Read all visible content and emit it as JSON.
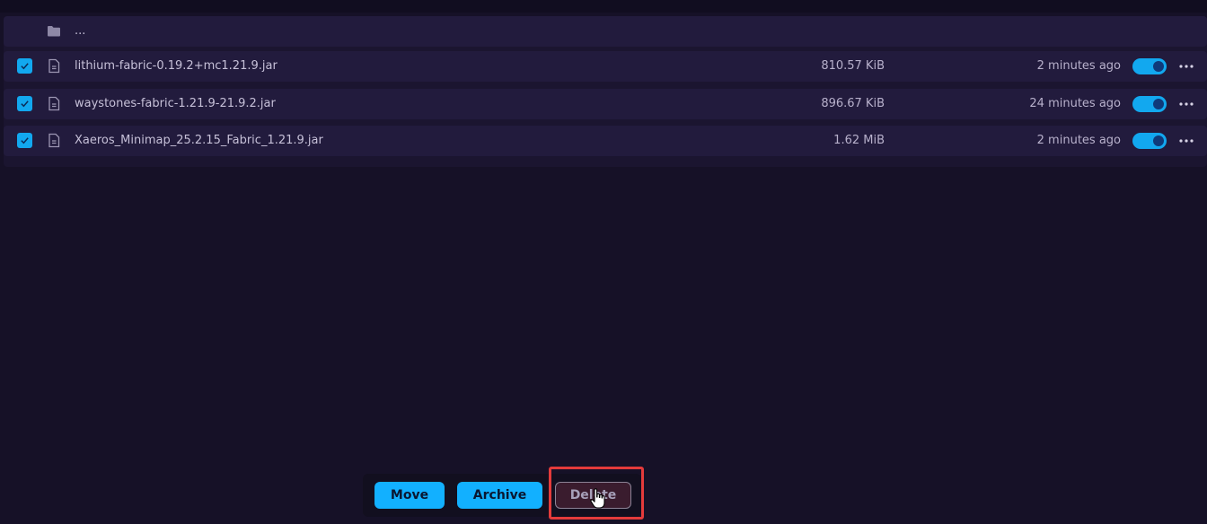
{
  "parent_row": {
    "label": "..."
  },
  "files": [
    {
      "name": "lithium-fabric-0.19.2+mc1.21.9.jar",
      "size": "810.57 KiB",
      "modified": "2 minutes ago",
      "checked": true,
      "enabled": true
    },
    {
      "name": "waystones-fabric-1.21.9-21.9.2.jar",
      "size": "896.67 KiB",
      "modified": "24 minutes ago",
      "checked": true,
      "enabled": true
    },
    {
      "name": "Xaeros_Minimap_25.2.15_Fabric_1.21.9.jar",
      "size": "1.62 MiB",
      "modified": "2 minutes ago",
      "checked": true,
      "enabled": true
    }
  ],
  "actions": {
    "move_label": "Move",
    "archive_label": "Archive",
    "delete_label": "Delete"
  },
  "colors": {
    "accent": "#12b0ff",
    "highlight": "#e43b3b",
    "background": "#161127"
  },
  "icons": {
    "folder": "folder-icon",
    "file": "file-icon",
    "checkbox": "check-icon",
    "more": "more-horizontal-icon",
    "cursor": "hand-pointer-icon"
  }
}
